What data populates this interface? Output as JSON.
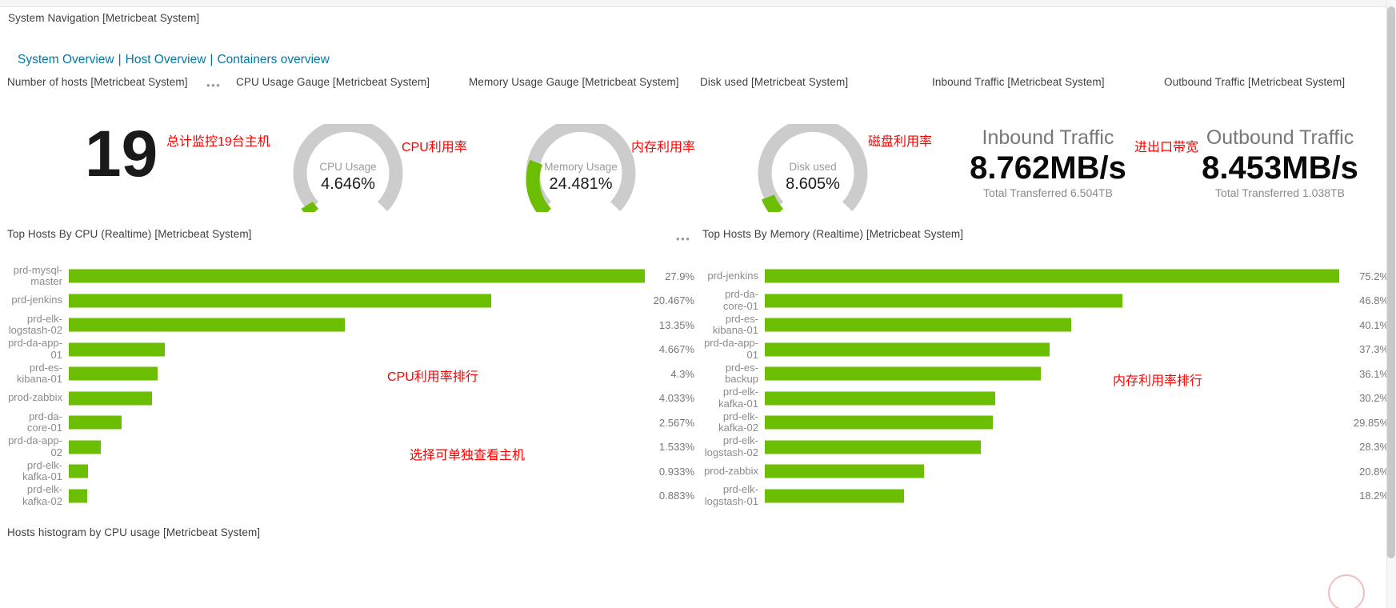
{
  "window": {
    "scrollbar": "vertical-scrollbar"
  },
  "nav_panel": {
    "title": "System Navigation [Metricbeat System]",
    "links": [
      {
        "label": "System Overview"
      },
      {
        "label": "Host Overview"
      },
      {
        "label": "Containers overview"
      }
    ],
    "separator": "|"
  },
  "panels": {
    "hosts_count": {
      "title": "Number of hosts [Metricbeat System]",
      "value": "19",
      "menu_icon": "ellipsis-icon"
    },
    "cpu_gauge": {
      "title": "CPU Usage Gauge [Metricbeat System]"
    },
    "memory_gauge": {
      "title": "Memory Usage Gauge [Metricbeat System]"
    },
    "disk_gauge": {
      "title": "Disk used [Metricbeat System]"
    },
    "inbound": {
      "title": "Inbound Traffic [Metricbeat System]"
    },
    "outbound": {
      "title": "Outbound Traffic [Metricbeat System]"
    },
    "top_cpu": {
      "title": "Top Hosts By CPU (Realtime) [Metricbeat System]",
      "menu_icon": "ellipsis-icon"
    },
    "top_memory": {
      "title": "Top Hosts By Memory (Realtime) [Metricbeat System]"
    },
    "histogram": {
      "title": "Hosts histogram by CPU usage [Metricbeat System]"
    }
  },
  "annotations": [
    {
      "text": "总计监控19台主机",
      "color": "#ff0000"
    },
    {
      "text": "CPU利用率",
      "color": "#ff0000"
    },
    {
      "text": "内存利用率",
      "color": "#ff0000"
    },
    {
      "text": "磁盘利用率",
      "color": "#ff0000"
    },
    {
      "text": "进出口带宽",
      "color": "#ff0000"
    },
    {
      "text": "CPU利用率排行",
      "color": "#ff0000"
    },
    {
      "text": "选择可单独查看主机",
      "color": "#ff0000"
    },
    {
      "text": "内存利用率排行",
      "color": "#ff0000"
    }
  ],
  "colors": {
    "accent_green": "#6cbe02",
    "gauge_track": "#cccccc",
    "link_blue": "#0079a5",
    "annotation_red": "#ff0000"
  },
  "chart_data": [
    {
      "type": "gauge",
      "title": "CPU Usage",
      "label": "CPU Usage",
      "value": 4.646,
      "value_text": "4.646%",
      "min": 0,
      "max": 100,
      "unit": "%"
    },
    {
      "type": "gauge",
      "title": "Memory Usage",
      "label": "Memory Usage",
      "value": 24.481,
      "value_text": "24.481%",
      "min": 0,
      "max": 100,
      "unit": "%"
    },
    {
      "type": "gauge",
      "title": "Disk used",
      "label": "Disk used",
      "value": 8.605,
      "value_text": "8.605%",
      "min": 0,
      "max": 100,
      "unit": "%"
    },
    {
      "type": "metric",
      "title": "Inbound Traffic",
      "value_text": "8.762MB/s",
      "value": 8.762,
      "unit": "MB/s",
      "subtitle_label": "Total Transferred",
      "subtitle_value": "6.504TB"
    },
    {
      "type": "metric",
      "title": "Outbound Traffic",
      "value_text": "8.453MB/s",
      "value": 8.453,
      "unit": "MB/s",
      "subtitle_label": "Total Transferred",
      "subtitle_value": "1.038TB"
    },
    {
      "type": "bar",
      "title": "Top Hosts By CPU (Realtime) [Metricbeat System]",
      "orientation": "horizontal",
      "xlabel": "",
      "ylabel": "",
      "xlim": [
        0,
        27.9
      ],
      "categories": [
        "prd-mysql-master",
        "prd-jenkins",
        "prd-elk-logstash-02",
        "prd-da-app-01",
        "prd-es-kibana-01",
        "prod-zabbix",
        "prd-da-core-01",
        "prd-da-app-02",
        "prd-elk-kafka-01",
        "prd-elk-kafka-02"
      ],
      "values": [
        27.9,
        20.467,
        13.35,
        4.667,
        4.3,
        4.033,
        2.567,
        1.533,
        0.933,
        0.883
      ],
      "value_labels": [
        "27.9%",
        "20.467%",
        "13.35%",
        "4.667%",
        "4.3%",
        "4.033%",
        "2.567%",
        "1.533%",
        "0.933%",
        "0.883%"
      ]
    },
    {
      "type": "bar",
      "title": "Top Hosts By Memory (Realtime) [Metricbeat System]",
      "orientation": "horizontal",
      "xlabel": "",
      "ylabel": "",
      "xlim": [
        0,
        75.2
      ],
      "categories": [
        "prd-jenkins",
        "prd-da-core-01",
        "prd-es-kibana-01",
        "prd-da-app-01",
        "prd-es-backup",
        "prd-elk-kafka-01",
        "prd-elk-kafka-02",
        "prd-elk-logstash-02",
        "prod-zabbix",
        "prd-elk-logstash-01"
      ],
      "values": [
        75.2,
        46.8,
        40.1,
        37.3,
        36.1,
        30.2,
        29.85,
        28.3,
        20.8,
        18.2
      ],
      "value_labels": [
        "75.2%",
        "46.8%",
        "40.1%",
        "37.3%",
        "36.1%",
        "30.2%",
        "29.85%",
        "28.3%",
        "20.8%",
        "18.2%"
      ]
    }
  ]
}
